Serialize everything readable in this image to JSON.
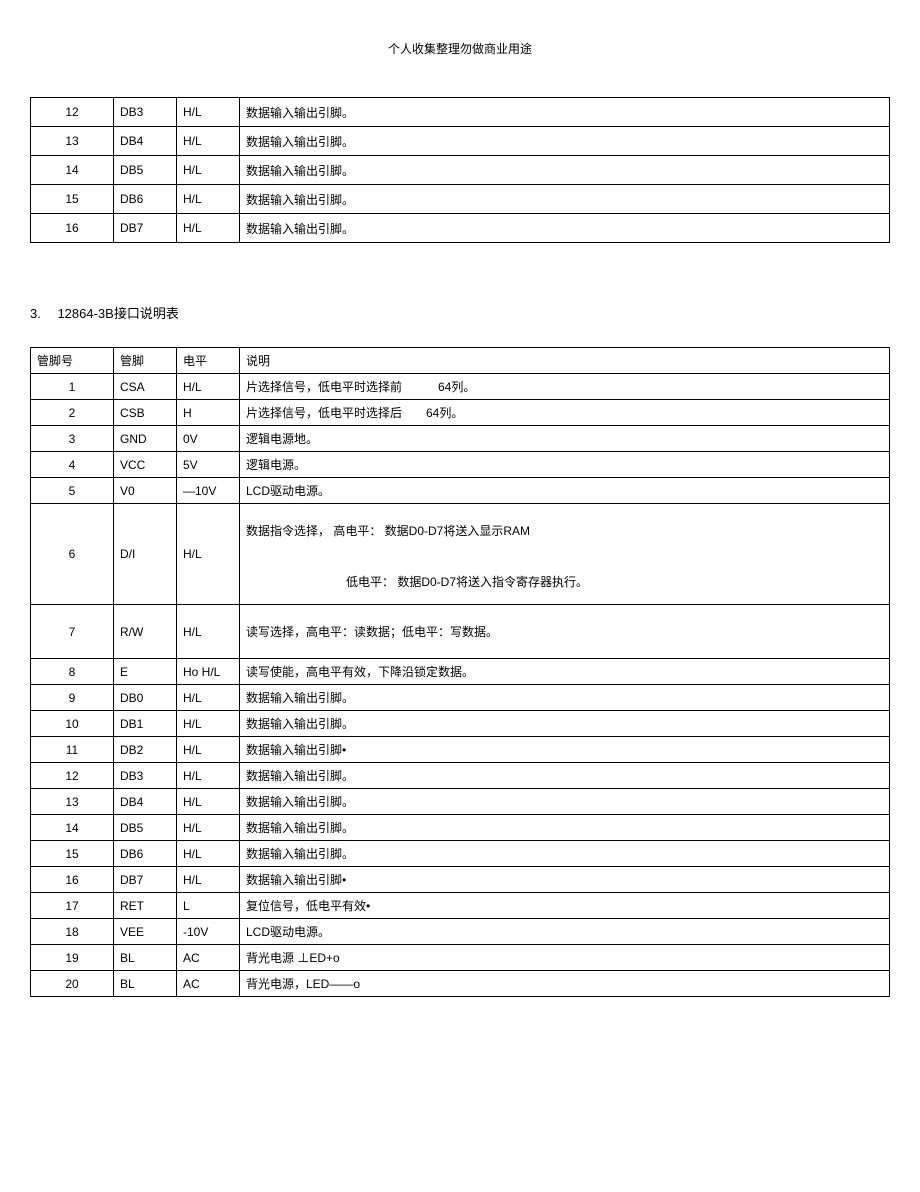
{
  "header_note": "个人收集整理勿做商业用途",
  "table1": {
    "rows": [
      {
        "num": "12",
        "pin": "DB3",
        "level": "H/L",
        "desc": "数据输入输出引脚。"
      },
      {
        "num": "13",
        "pin": "DB4",
        "level": "H/L",
        "desc": "数据输入输出引脚。"
      },
      {
        "num": "14",
        "pin": "DB5",
        "level": "H/L",
        "desc": "数据输入输出引脚。"
      },
      {
        "num": "15",
        "pin": "DB6",
        "level": "H/L",
        "desc": "数据输入输出引脚。"
      },
      {
        "num": "16",
        "pin": "DB7",
        "level": "H/L",
        "desc": "数据输入输出引脚。"
      }
    ]
  },
  "section_title": "3.  12864-3B接口说明表",
  "table2": {
    "header": {
      "num": "管脚号",
      "pin": "管脚",
      "level": "电平",
      "desc": "说明"
    },
    "rows": [
      {
        "num": "1",
        "pin": "CSA",
        "level": "H/L",
        "desc": "片选择信号，低电平时选择前   64列。"
      },
      {
        "num": "2",
        "pin": "CSB",
        "level": "H",
        "desc": "片选择信号，低电平时选择后  64列。"
      },
      {
        "num": "3",
        "pin": "GND",
        "level": "0V",
        "desc": "逻辑电源地。"
      },
      {
        "num": "4",
        "pin": "VCC",
        "level": "5V",
        "desc": "逻辑电源。"
      },
      {
        "num": "5",
        "pin": "V0",
        "level": "—10V",
        "desc": "LCD驱动电源。"
      },
      {
        "num": "6",
        "pin": "D/I",
        "level": "H/L",
        "desc": "数据指令选择，  高电平：  数据D0-D7将送入显示RAM",
        "desc2": "低电平：  数据D0-D7将送入指令寄存器执行。",
        "tall": true
      },
      {
        "num": "7",
        "pin": "R/W",
        "level": "H/L",
        "desc": "读写选择，高电平：读数据；低电平：写数据。",
        "med": true
      },
      {
        "num": "8",
        "pin": "E",
        "level": "Ho H/L",
        "desc": "读写使能，高电平有效，下降沿锁定数据。"
      },
      {
        "num": "9",
        "pin": "DB0",
        "level": "H/L",
        "desc": "数据输入输出引脚。"
      },
      {
        "num": "10",
        "pin": "DB1",
        "level": "H/L",
        "desc": "数据输入输出引脚。"
      },
      {
        "num": "11",
        "pin": "DB2",
        "level": "H/L",
        "desc": "数据输入输出引脚•"
      },
      {
        "num": "12",
        "pin": "DB3",
        "level": "H/L",
        "desc": "数据输入输出引脚。"
      },
      {
        "num": "13",
        "pin": "DB4",
        "level": "H/L",
        "desc": "数据输入输出引脚。"
      },
      {
        "num": "14",
        "pin": "DB5",
        "level": "H/L",
        "desc": "数据输入输出引脚。"
      },
      {
        "num": "15",
        "pin": "DB6",
        "level": "H/L",
        "desc": "数据输入输出引脚。"
      },
      {
        "num": "16",
        "pin": "DB7",
        "level": "H/L",
        "desc": "数据输入输出引脚•"
      },
      {
        "num": "17",
        "pin": "RET",
        "level": "L",
        "desc": "复位信号，低电平有效•"
      },
      {
        "num": "18",
        "pin": "VEE",
        "level": "-10V",
        "desc": "LCD驱动电源。"
      },
      {
        "num": "19",
        "pin": "BL",
        "level": "AC",
        "desc": "背光电源 ⊥ED+o"
      },
      {
        "num": "20",
        "pin": "BL",
        "level": "AC",
        "desc": "背光电源，LED——o"
      }
    ]
  }
}
